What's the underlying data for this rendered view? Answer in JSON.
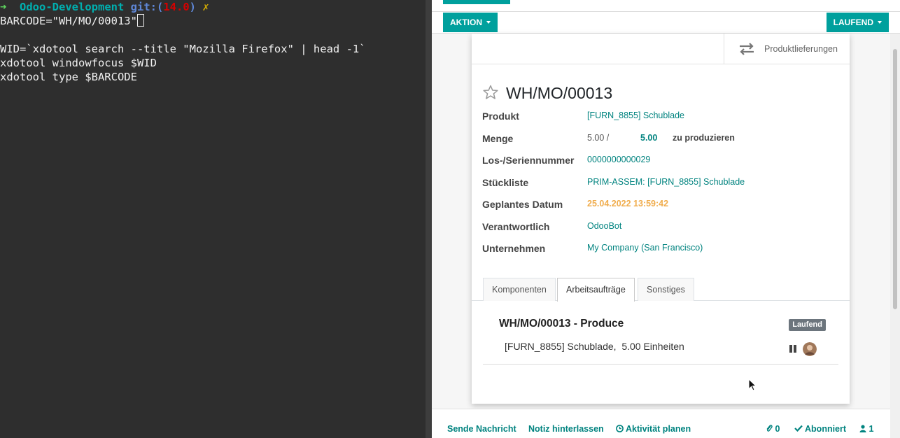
{
  "terminal": {
    "prompt_arrow": "➜",
    "prompt_dir": "Odoo-Development",
    "prompt_git": "git:",
    "prompt_paren_open": "(",
    "prompt_branch": "14.0",
    "prompt_paren_close": ")",
    "prompt_mark": "✗",
    "line1": "BARCODE=\"WH/MO/00013\"",
    "line3": "WID=`xdotool search --title \"Mozilla Firefox\" | head -1`",
    "line4": "xdotool windowfocus $WID",
    "line5": "xdotool type $BARCODE"
  },
  "odoo": {
    "action_button": "AKTION",
    "status_button": "LAUFEND",
    "smart_button": "Produktlieferungen",
    "record_title": "WH/MO/00013",
    "fields": {
      "produkt_label": "Produkt",
      "produkt_value": "[FURN_8855] Schublade",
      "menge_label": "Menge",
      "menge_current": "5.00 /",
      "menge_target": "5.00",
      "menge_suffix": "zu produzieren",
      "los_label": "Los-/Seriennummer",
      "los_value": "0000000000029",
      "stueckliste_label": "Stückliste",
      "stueckliste_value": "PRIM-ASSEM: [FURN_8855] Schublade",
      "datum_label": "Geplantes Datum",
      "datum_value": "25.04.2022 13:59:42",
      "verantwortlich_label": "Verantwortlich",
      "verantwortlich_value": "OdooBot",
      "unternehmen_label": "Unternehmen",
      "unternehmen_value": "My Company (San Francisco)"
    },
    "tabs": [
      "Komponenten",
      "Arbeitsaufträge",
      "Sonstiges"
    ],
    "active_tab": "Arbeitsaufträge",
    "workorder": {
      "title": "WH/MO/00013 - Produce",
      "badge": "Laufend",
      "description": "[FURN_8855] Schublade,  5.00 Einheiten"
    },
    "chatter": {
      "send_message": "Sende Nachricht",
      "log_note": "Notiz hinterlassen",
      "schedule_activity": "Aktivität planen",
      "attachments_count": "0",
      "follow": "Abonniert",
      "followers_count": "1"
    },
    "colors": {
      "primary": "#00a09d",
      "link": "#00837f",
      "warning": "#f0ad4e",
      "badge": "#6c757d"
    }
  }
}
